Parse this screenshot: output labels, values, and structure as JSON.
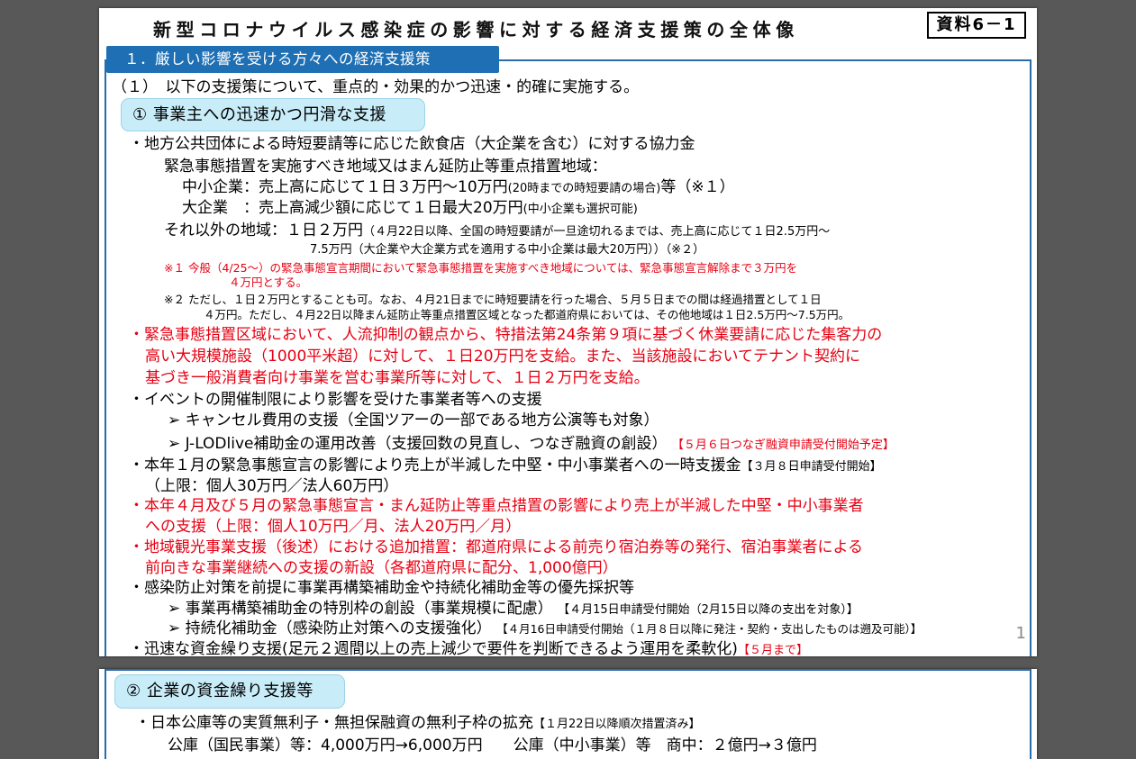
{
  "page1": {
    "title": "新型コロナウイルス感染症の影響に対する経済支援策の全体像",
    "doc_label": "資料6－1",
    "section_heading": "１．厳しい影響を受ける方々への経済支援策",
    "intro": "（１）　以下の支援策について、重点的・効果的かつ迅速・的確に実施する。",
    "pill1": "①  事業主への迅速かつ円滑な支援",
    "b1": "・地方公共団体による時短要請等に応じた飲食店（大企業を含む）に対する協力金",
    "b1_sub": "緊急事態措置を実施すべき地域又はまん延防止等重点措置地域：",
    "b1_sme_a": "中小企業：売上高に応じて１日３万円～10万円",
    "b1_sme_b": "(20時までの時短要請の場合)",
    "b1_sme_c": "等（※１）",
    "b1_large_a": "大企業　：売上高減少額に応じて１日最大20万円",
    "b1_large_b": "(中小企業も選択可能)",
    "b1_other_a": "それ以外の地域：１日２万円",
    "b1_other_b": "（４月22日以降、全国の時短要請が一旦途切れるまでは、売上高に応じて１日2.5万円～",
    "b1_other_c": "7.5万円（大企業や大企業方式を適用する中小企業は最大20万円））（※２）",
    "note1_a": "※１ 今般（4/25～）の緊急事態宣言期間において緊急事態措置を実施すべき地域については、緊急事態宣言解除まで３万円を",
    "note1_b": "４万円とする。",
    "note2_a": "※２ ただし、１日２万円とすることも可。なお、４月21日までに時短要請を行った場合、５月５日までの間は経過措置として１日",
    "note2_b": "４万円。ただし、４月22日以降まん延防止等重点措置区域となった都道府県においては、その他地域は１日2.5万円～7.5万円。",
    "b2_a": "・緊急事態措置区域において、人流抑制の観点から、特措法第24条第９項に基づく休業要請に応じた集客力の",
    "b2_b": "高い大規模施設（1000平米超）に対して、１日20万円を支給。また、当該施設においてテナント契約に",
    "b2_c": "基づき一般消費者向け事業を営む事業所等に対して、１日２万円を支給。",
    "b3": "・イベントの開催制限により影響を受けた事業者等への支援",
    "b3_1": "➢  キャンセル費用の支援（全国ツアーの一部である地方公演等も対象）",
    "b3_2": "➢  J-LODlive補助金の運用改善（支援回数の見直し、つなぎ融資の創設）",
    "b3_2_tag": "【５月６日つなぎ融資申請受付開始予定】",
    "b4": "・本年１月の緊急事態宣言の影響により売上が半減した中堅・中小事業者への一時支援金",
    "b4_tag": "【３月８日申請受付開始】",
    "b4_sub": "（上限：個人30万円／法人60万円）",
    "b5_a": "・本年４月及び５月の緊急事態宣言・まん延防止等重点措置の影響により売上が半減した中堅・中小事業者",
    "b5_b": "への支援（上限：個人10万円／月、法人20万円／月）",
    "b6_a": "・地域観光事業支援（後述）における追加措置：都道府県による前売り宿泊券等の発行、宿泊事業者による",
    "b6_b": "前向きな事業継続への支援の新設（各都道府県に配分、1,000億円）",
    "b7": "・感染防止対策を前提に事業再構築補助金や持続化補助金等の優先採択等",
    "b7_1": "➢  事業再構築補助金の特別枠の創設（事業規模に配慮）",
    "b7_1_tag": "【４月15日申請受付開始（2月15日以降の支出を対象）】",
    "b7_2": "➢  持続化補助金（感染防止対策への支援強化）",
    "b7_2_tag": "【４月16日申請受付開始（１月８日以降に発注・契約・支出したものは遡及可能）】",
    "b8": "・迅速な資金繰り支援(足元２週間以上の売上減少で要件を判断できるよう運用を柔軟化)",
    "b8_tag": "【５月まで】",
    "page_number": "1"
  },
  "page2": {
    "pill2": "②  企業の資金繰り支援等",
    "c1": "・日本公庫等の実質無利子・無担保融資の無利子枠の拡充",
    "c1_tag": "【１月22日以降順次措置済み】",
    "c2": "公庫（国民事業）等：4,000万円→6,000万円　　公庫（中小事業）等　商中：２億円→３億円"
  }
}
